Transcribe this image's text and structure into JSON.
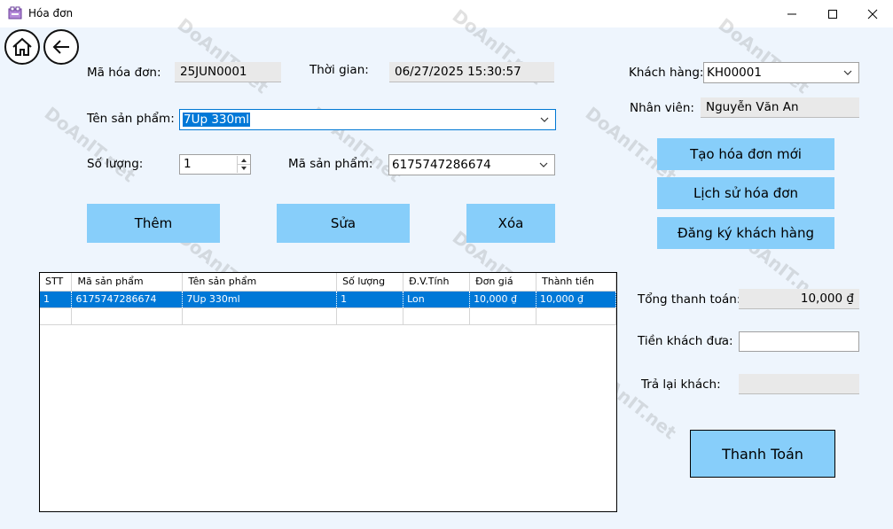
{
  "window": {
    "title": "Hóa đơn"
  },
  "nav": {
    "home_icon": "home-icon",
    "back_icon": "back-arrow-icon"
  },
  "form": {
    "invoice_id_label": "Mã hóa đơn:",
    "invoice_id_value": "25JUN0001",
    "time_label": "Thời gian:",
    "time_value": "06/27/2025 15:30:57",
    "product_name_label": "Tên sản phẩm:",
    "product_name_value": "7Up 330ml",
    "quantity_label": "Số lượng:",
    "quantity_value": "1",
    "product_code_label": "Mã sản phẩm:",
    "product_code_value": "6175747286674",
    "customer_label": "Khách hàng:",
    "customer_value": "KH00001",
    "employee_label": "Nhân viên:",
    "employee_value": "Nguyễn Văn An"
  },
  "buttons": {
    "add": "Thêm",
    "edit": "Sửa",
    "delete": "Xóa",
    "new_invoice": "Tạo hóa đơn mới",
    "invoice_history": "Lịch sử hóa đơn",
    "register_customer": "Đăng ký khách hàng",
    "pay": "Thanh Toán"
  },
  "table": {
    "columns": [
      "STT",
      "Mã sản phẩm",
      "Tên sản phẩm",
      "Số lượng",
      "Đ.V.Tính",
      "Đơn giá",
      "Thành tiền"
    ],
    "rows": [
      [
        "1",
        "6175747286674",
        "7Up 330ml",
        "1",
        "Lon",
        "10,000 ₫",
        "10,000 ₫"
      ]
    ]
  },
  "payment": {
    "total_label": "Tổng thanh toán:",
    "total_value": "10,000 ₫",
    "cash_label": "Tiền khách đưa:",
    "cash_value": "",
    "change_label": "Trả lại khách:",
    "change_value": ""
  },
  "watermark": {
    "text": "DoAnIT.net"
  },
  "colors": {
    "button_fill": "#87cefa",
    "selection": "#0078d7",
    "background": "#eef5fd"
  }
}
